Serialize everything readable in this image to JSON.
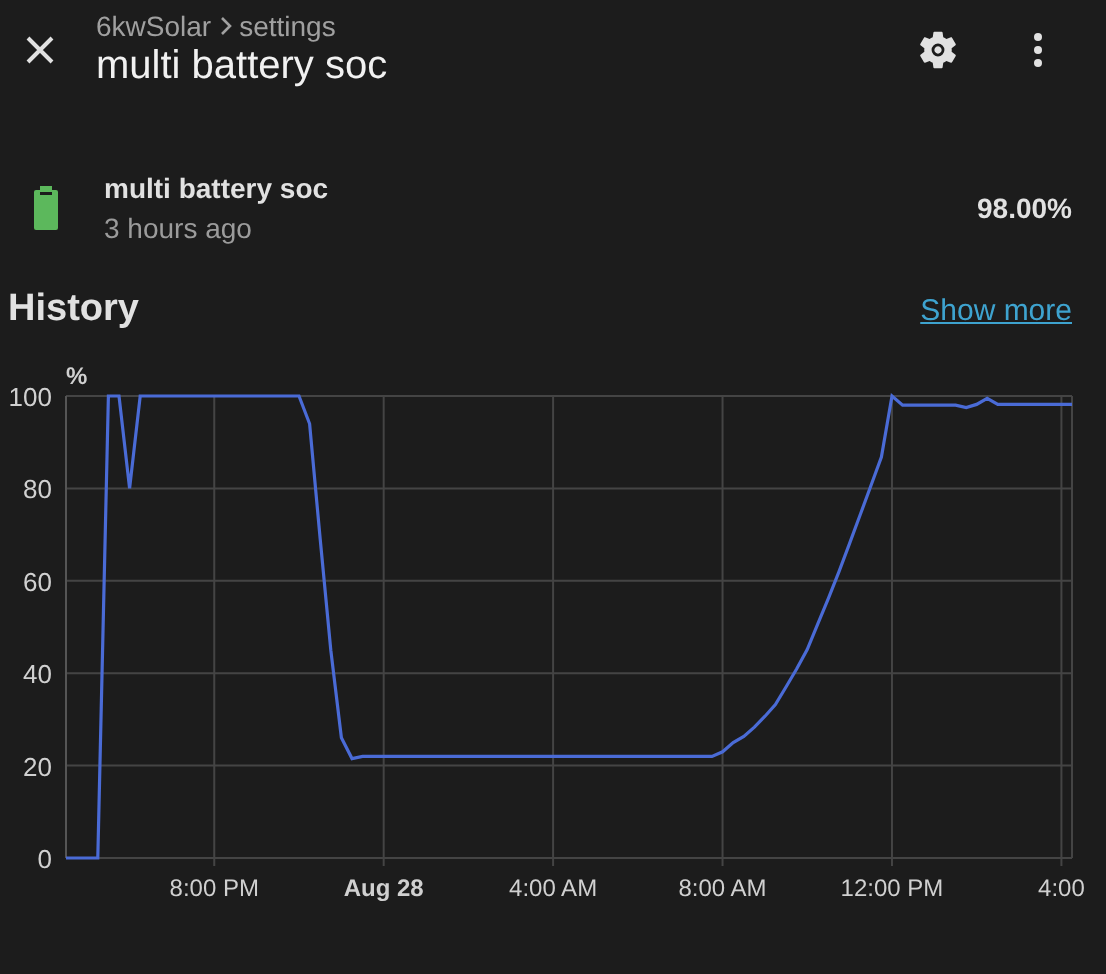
{
  "header": {
    "breadcrumb": [
      "6kwSolar",
      "settings"
    ],
    "title": "multi battery soc"
  },
  "entity": {
    "name": "multi battery soc",
    "time": "3 hours ago",
    "value": "98.00%"
  },
  "history": {
    "title": "History",
    "link": "Show more",
    "chart_data": {
      "type": "line",
      "ylabel": "%",
      "ylim": [
        0,
        100
      ],
      "yticks": [
        0,
        20,
        40,
        60,
        80,
        100
      ],
      "categories": [
        null,
        null,
        null,
        null,
        null,
        null,
        null,
        null,
        null,
        null,
        null,
        null,
        null,
        null,
        "8:00 PM",
        null,
        null,
        null,
        null,
        null,
        null,
        null,
        null,
        null,
        null,
        null,
        null,
        null,
        null,
        null,
        "Aug 28",
        null,
        null,
        null,
        null,
        null,
        null,
        null,
        null,
        null,
        null,
        null,
        null,
        null,
        null,
        null,
        "4:00 AM",
        null,
        null,
        null,
        null,
        null,
        null,
        null,
        null,
        null,
        null,
        null,
        null,
        null,
        null,
        null,
        "8:00 AM",
        null,
        null,
        null,
        null,
        null,
        null,
        null,
        null,
        null,
        null,
        null,
        null,
        null,
        null,
        null,
        "12:00 PM",
        null,
        null,
        null,
        null,
        null,
        null,
        null,
        null,
        null,
        null,
        null,
        null,
        null,
        null,
        null,
        "4:00",
        null
      ],
      "series": [
        {
          "color": "#4a6bd6",
          "values": [
            0,
            0,
            0,
            0,
            100,
            100,
            80,
            100,
            100,
            100,
            100,
            100,
            100,
            100,
            100,
            100,
            100,
            100,
            100,
            100,
            100,
            100,
            100,
            94,
            69,
            45,
            26,
            21.5,
            22,
            22,
            22,
            22,
            22,
            22,
            22,
            22,
            22,
            22,
            22,
            22,
            22,
            22,
            22,
            22,
            22,
            22,
            22,
            22,
            22,
            22,
            22,
            22,
            22,
            22,
            22,
            22,
            22,
            22,
            22,
            22,
            22,
            22,
            23,
            25,
            26.3,
            28.3,
            30.7,
            33.2,
            37,
            40.9,
            45.1,
            50.7,
            56.2,
            62,
            68.1,
            74.3,
            80.5,
            86.8,
            100,
            98,
            98,
            98,
            98,
            98,
            98,
            97.5,
            98.2,
            99.5,
            98.2,
            98.2,
            98.2,
            98.2,
            98.2,
            98.2,
            98.2,
            98.2
          ]
        }
      ],
      "grid": true
    }
  }
}
